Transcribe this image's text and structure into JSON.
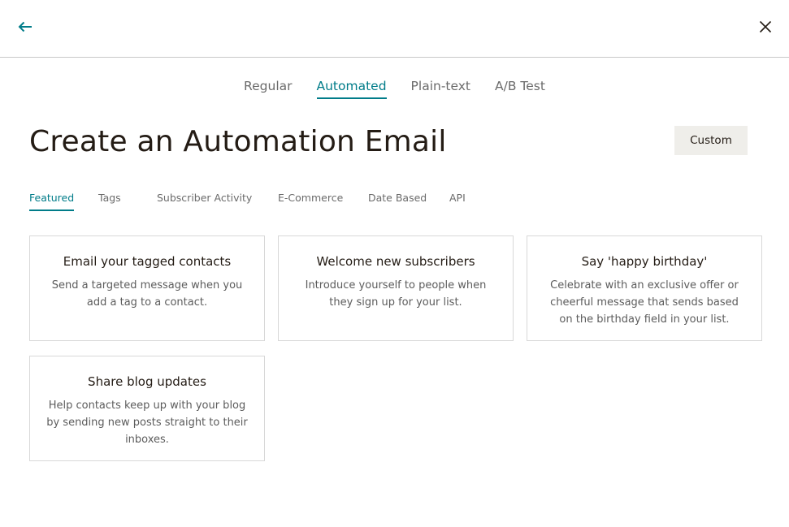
{
  "header": {
    "back_icon": "arrow-left-icon",
    "close_icon": "close-icon",
    "accent_color": "#007c89"
  },
  "type_tabs": [
    {
      "label": "Regular",
      "active": false
    },
    {
      "label": "Automated",
      "active": true
    },
    {
      "label": "Plain-text",
      "active": false
    },
    {
      "label": "A/B Test",
      "active": false
    }
  ],
  "title": "Create an Automation Email",
  "custom_button": "Custom",
  "category_tabs": [
    {
      "label": "Featured",
      "active": true
    },
    {
      "label": "Tags",
      "active": false
    },
    {
      "label": "Subscriber Activity",
      "active": false
    },
    {
      "label": "E-Commerce",
      "active": false
    },
    {
      "label": "Date Based",
      "active": false
    },
    {
      "label": "API",
      "active": false
    }
  ],
  "cards": [
    {
      "title": "Email your tagged contacts",
      "description": "Send a targeted message when you add a tag to a contact."
    },
    {
      "title": "Welcome new subscribers",
      "description": "Introduce yourself to people when they sign up for your list."
    },
    {
      "title": "Say 'happy birthday'",
      "description": "Celebrate with an exclusive offer or cheerful message that sends based on the birthday field in your list."
    },
    {
      "title": "Share blog updates",
      "description": "Help contacts keep up with your blog by sending new posts straight to their inboxes."
    }
  ]
}
